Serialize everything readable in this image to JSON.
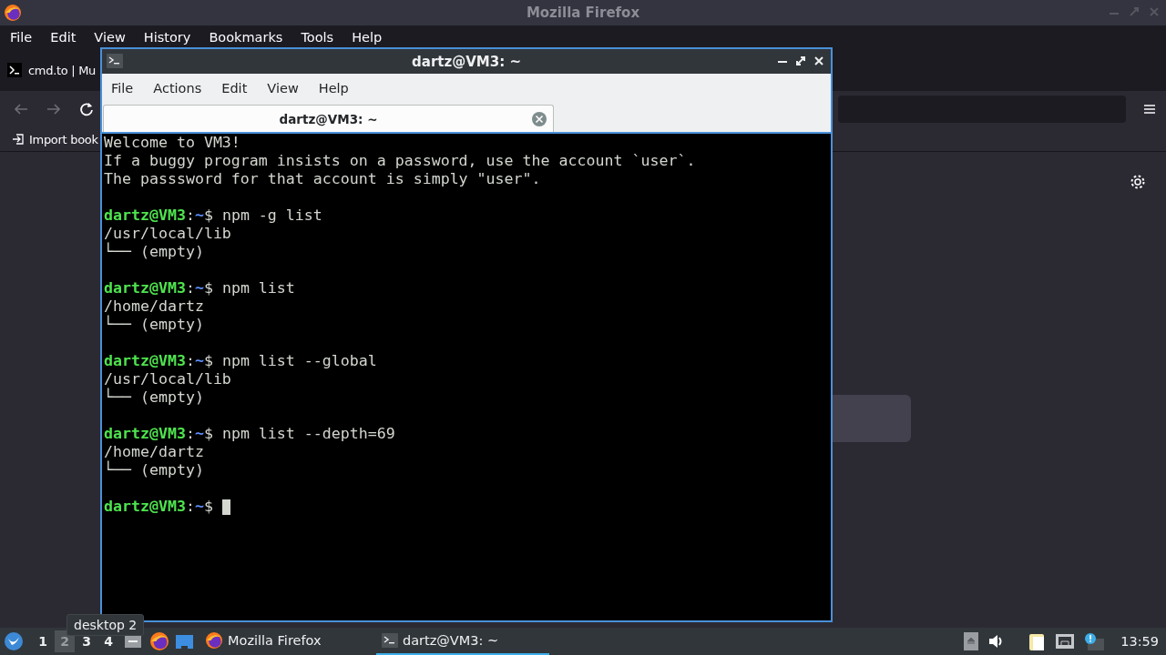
{
  "firefox": {
    "title": "Mozilla Firefox",
    "menu": [
      "File",
      "Edit",
      "View",
      "History",
      "Bookmarks",
      "Tools",
      "Help"
    ],
    "tabs": [
      {
        "label": "cmd.to | Mu",
        "selected": true
      }
    ],
    "bookmarks": [
      "Import book"
    ]
  },
  "terminal": {
    "title": "dartz@VM3: ~",
    "menu": [
      "File",
      "Actions",
      "Edit",
      "View",
      "Help"
    ],
    "tabs": [
      {
        "label": "dartz@VM3: ~",
        "selected": true
      }
    ],
    "lines": [
      {
        "kind": "output",
        "text": "Welcome to VM3!"
      },
      {
        "kind": "output",
        "text": "If a buggy program insists on a password, use the account `user`."
      },
      {
        "kind": "output",
        "text": "The passsword for that account is simply \"user\"."
      },
      {
        "kind": "blank"
      },
      {
        "kind": "prompt",
        "user": "dartz@VM3",
        "separator": ":",
        "path": "~",
        "command": "$ npm -g list"
      },
      {
        "kind": "output",
        "text": "/usr/local/lib"
      },
      {
        "kind": "output",
        "text": "└── (empty)"
      },
      {
        "kind": "blank"
      },
      {
        "kind": "prompt",
        "user": "dartz@VM3",
        "separator": ":",
        "path": "~",
        "command": "$ npm list"
      },
      {
        "kind": "output",
        "text": "/home/dartz"
      },
      {
        "kind": "output",
        "text": "└── (empty)"
      },
      {
        "kind": "blank"
      },
      {
        "kind": "prompt",
        "user": "dartz@VM3",
        "separator": ":",
        "path": "~",
        "command": "$ npm list --global"
      },
      {
        "kind": "output",
        "text": "/usr/local/lib"
      },
      {
        "kind": "output",
        "text": "└── (empty)"
      },
      {
        "kind": "blank"
      },
      {
        "kind": "prompt",
        "user": "dartz@VM3",
        "separator": ":",
        "path": "~",
        "command": "$ npm list --depth=69"
      },
      {
        "kind": "output",
        "text": "/home/dartz"
      },
      {
        "kind": "output",
        "text": "└── (empty)"
      },
      {
        "kind": "blank"
      },
      {
        "kind": "prompt",
        "user": "dartz@VM3",
        "separator": ":",
        "path": "~",
        "command": "$",
        "cursor": true
      }
    ]
  },
  "taskbar": {
    "workspaces": [
      {
        "label": "1",
        "selected": false
      },
      {
        "label": "2",
        "selected": true
      },
      {
        "label": "3",
        "selected": false
      },
      {
        "label": "4",
        "selected": false
      }
    ],
    "tooltip": "desktop 2",
    "tasks": [
      {
        "kind": "firefox",
        "label": "Mozilla Firefox",
        "selected": false
      },
      {
        "kind": "terminal",
        "label": "dartz@VM3: ~",
        "selected": true
      }
    ],
    "clock": "13:59"
  }
}
